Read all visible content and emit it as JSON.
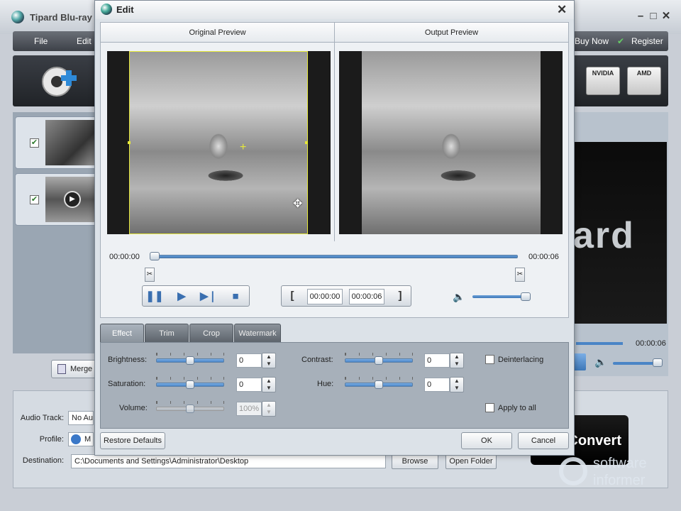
{
  "main": {
    "title": "Tipard Blu-ray",
    "menu": {
      "file": "File",
      "edit": "Edit",
      "buy_now": "Buy Now",
      "register": "Register"
    },
    "gpu_badges": [
      "NVIDIA",
      "AMD"
    ],
    "merge_label": "Merge",
    "preview_brand_text": "ard",
    "preview_time": "00:00:06",
    "audio_track_label": "Audio Track:",
    "audio_track_value": "No Au",
    "profile_label": "Profile:",
    "profile_value": "M",
    "destination_label": "Destination:",
    "destination_value": "C:\\Documents and Settings\\Administrator\\Desktop",
    "browse_label": "Browse",
    "open_folder_label": "Open Folder",
    "convert_label": "Convert",
    "watermark_line1": "software",
    "watermark_line2": "informer"
  },
  "edit": {
    "title": "Edit",
    "original_preview": "Original Preview",
    "output_preview": "Output Preview",
    "time_start": "00:00:00",
    "time_end": "00:00:06",
    "trim_start": "00:00:00",
    "trim_end": "00:00:06",
    "volume_level": 0.9,
    "tabs": [
      {
        "label": "Effect",
        "active": true
      },
      {
        "label": "Trim",
        "active": false
      },
      {
        "label": "Crop",
        "active": false
      },
      {
        "label": "Watermark",
        "active": false
      }
    ],
    "effect": {
      "brightness_label": "Brightness:",
      "brightness_value": "0",
      "saturation_label": "Saturation:",
      "saturation_value": "0",
      "volume_label": "Volume:",
      "volume_value": "100%",
      "contrast_label": "Contrast:",
      "contrast_value": "0",
      "hue_label": "Hue:",
      "hue_value": "0",
      "deinterlacing_label": "Deinterlacing",
      "apply_all_label": "Apply to all"
    },
    "restore_label": "Restore Defaults",
    "ok_label": "OK",
    "cancel_label": "Cancel"
  }
}
